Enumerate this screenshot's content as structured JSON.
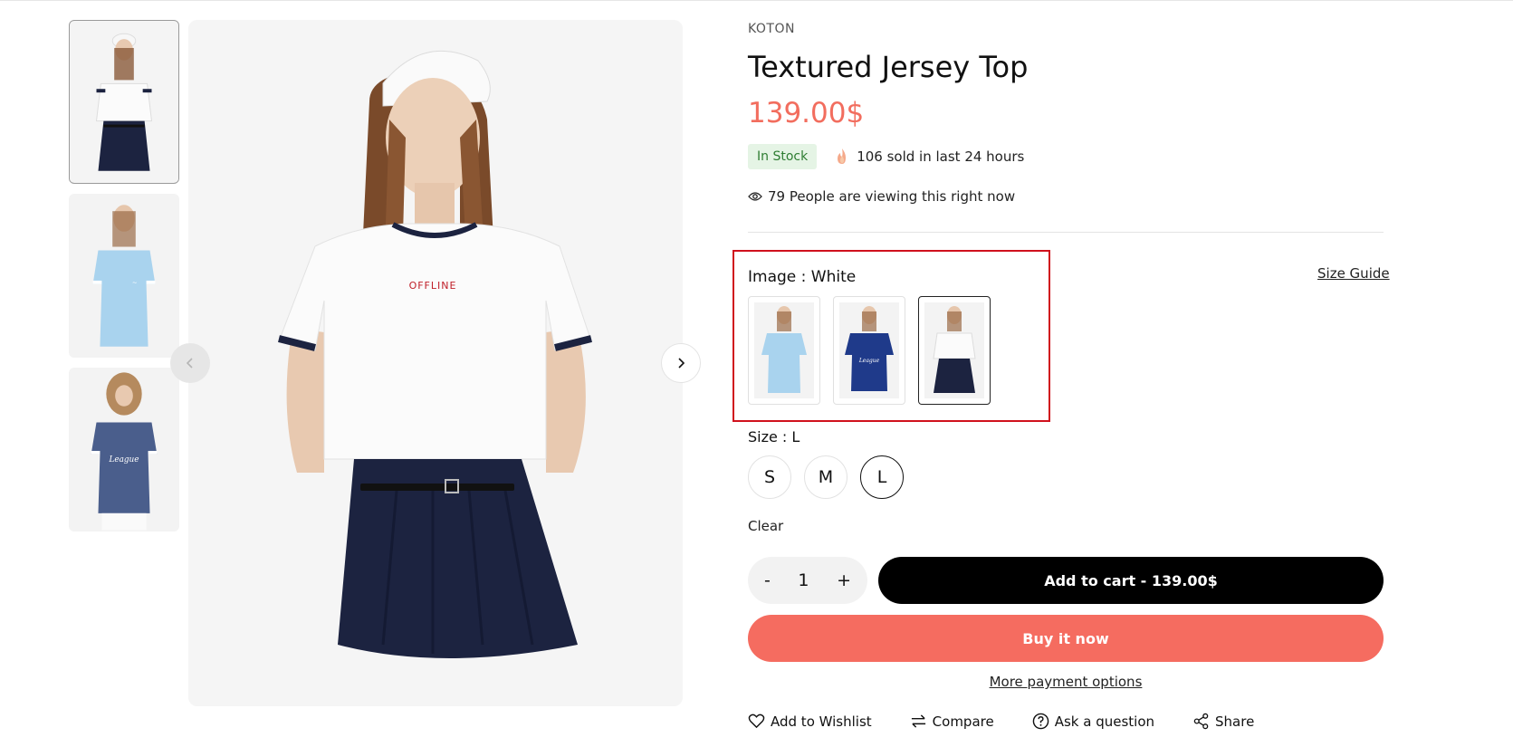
{
  "product": {
    "vendor": "KOTON",
    "title": "Textured Jersey Top",
    "price": "139.00$",
    "stock_badge": "In Stock",
    "sold_text": "106 sold in last 24 hours",
    "viewing_text": "79 People are viewing this right now"
  },
  "variant": {
    "label": "Image :",
    "selected": "White",
    "size_guide": "Size Guide",
    "swatches": [
      "light-blue-top",
      "navy-athleisure-top",
      "white-top-navy-skirt"
    ]
  },
  "size": {
    "label": "Size :",
    "selected": "L",
    "options": [
      "S",
      "M",
      "L"
    ],
    "clear": "Clear"
  },
  "cart": {
    "minus": "-",
    "quantity": "1",
    "plus": "+",
    "add_to_cart": "Add to cart - 139.00$",
    "buy_now": "Buy it now",
    "more_payment": "More payment options"
  },
  "actions": {
    "wishlist": "Add to Wishlist",
    "compare": "Compare",
    "ask": "Ask a question",
    "share": "Share"
  },
  "gallery": {
    "shirt_print": "OFFLINE"
  },
  "colors": {
    "price": "#f26d5e",
    "buy_now": "#f56c60",
    "stock_bg": "#e5f4e5",
    "stock_text": "#2e7d32",
    "highlight_box": "#d0111d"
  },
  "icons": [
    "chevron-left-icon",
    "chevron-right-icon",
    "fire-icon",
    "eye-icon",
    "heart-icon",
    "compare-icon",
    "question-icon",
    "share-icon"
  ]
}
